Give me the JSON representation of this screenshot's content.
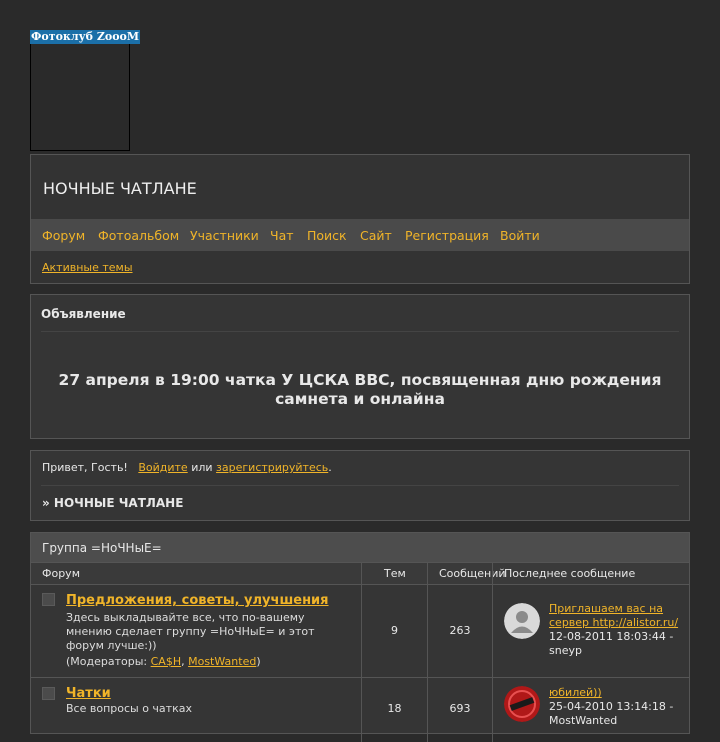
{
  "logo": {
    "label": "Фотоклуб ZoooM"
  },
  "header": {
    "title": "НОЧНЫЕ ЧАТЛАНЕ",
    "nav": [
      "Форум",
      "Фотоальбом",
      "Участники",
      "Чат",
      "Поиск",
      "Сайт",
      "Регистрация",
      "Войти"
    ],
    "active_topics": "Активные темы"
  },
  "announcement": {
    "heading": "Объявление",
    "message": "27 апреля в 19:00 чатка У ЦСКА ВВС, посвященная дню рождения самнета и онлайна"
  },
  "greeting": {
    "hello": "Привет, Гость!",
    "login": "Войдите",
    "or": "или",
    "register": "зарегистрируйтесь",
    "period": ".",
    "breadcrumb": "» НОЧНЫЕ ЧАТЛАНЕ"
  },
  "forum_group": {
    "title": "Группа =НоЧНыЕ=",
    "columns": {
      "forum": "Форум",
      "topics": "Тем",
      "posts": "Сообщений",
      "last": "Последнее сообщение"
    },
    "rows": [
      {
        "title": "Предложения, советы, улучшения",
        "description": "Здесь выкладывайте все, что по-вашему мнению сделает группу =НоЧНыЕ= и этот форум лучше:))",
        "moderators_prefix": "(Модераторы:",
        "moderator1": "CA$H",
        "comma": ",",
        "moderator2": "MostWanted",
        "moderators_suffix": ")",
        "topics": "9",
        "posts": "263",
        "last_title": "Приглашаем вас на сервер http://alistor.ru/",
        "last_date": "12-08-2011 18:03:44 -",
        "last_user": "sneyp"
      },
      {
        "title": "Чатки",
        "description": "Все вопросы о чатках",
        "topics": "18",
        "posts": "693",
        "last_title": "юбилей))",
        "last_date": "25-04-2010 13:14:18 -",
        "last_user": "MostWanted"
      }
    ]
  }
}
